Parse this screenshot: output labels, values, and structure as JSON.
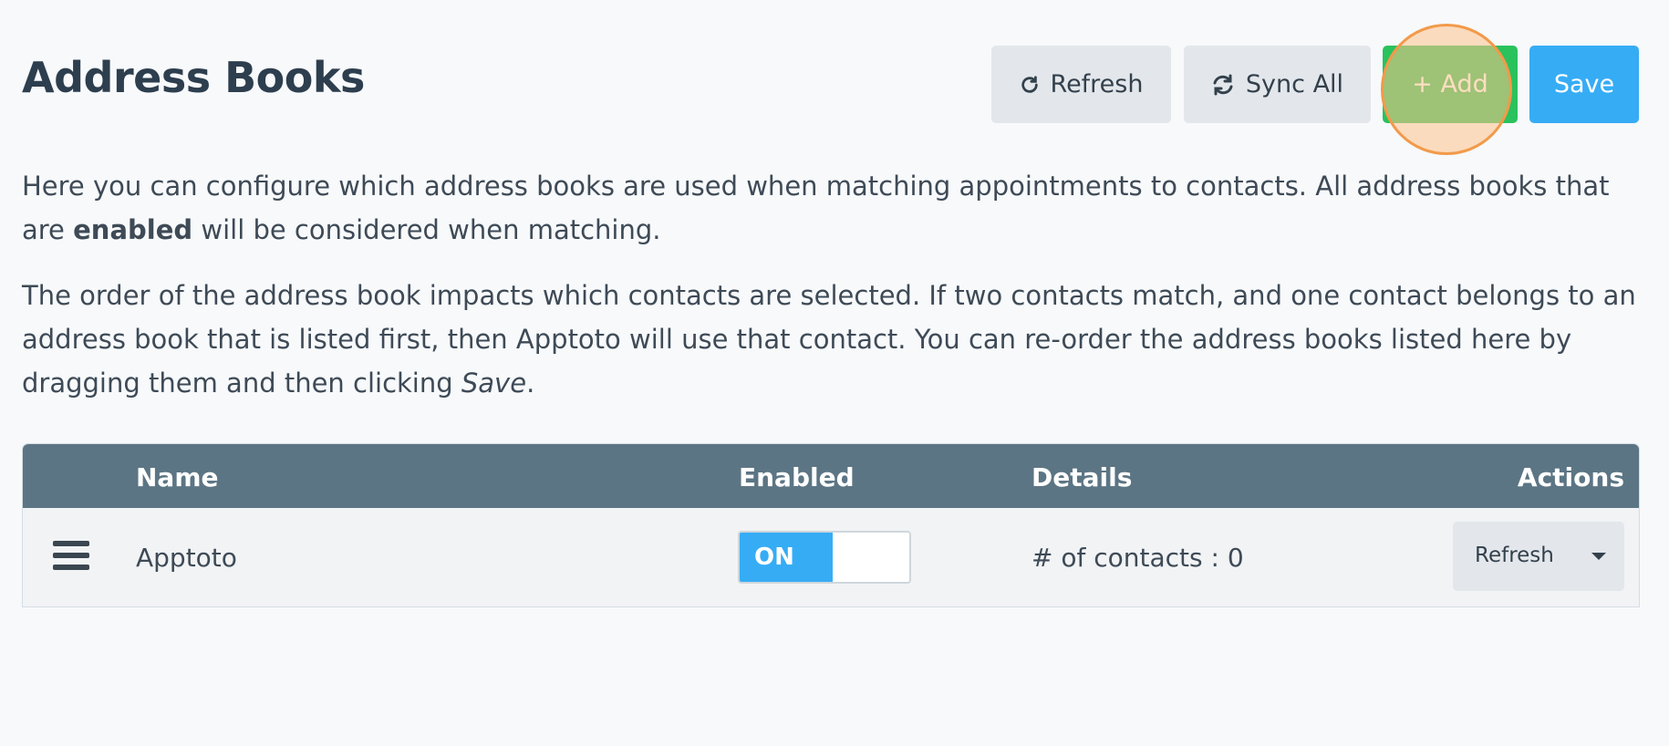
{
  "header": {
    "title": "Address Books",
    "refresh_label": "Refresh",
    "refresh_icon": "refresh-icon",
    "sync_label": "Sync All",
    "sync_icon": "sync-icon",
    "add_label": "+ Add",
    "save_label": "Save"
  },
  "description": {
    "p1_before": "Here you can configure which address books are used when matching appointments to contacts. All address books that are ",
    "p1_bold": "enabled",
    "p1_after": " will be considered when matching.",
    "p2_before": "The order of the address book impacts which contacts are selected. If two contacts match, and one contact belongs to an address book that is listed first, then Apptoto will use that contact. You can re-order the address books listed here by dragging them and then clicking ",
    "p2_italic": "Save",
    "p2_after": "."
  },
  "table": {
    "headers": {
      "name": "Name",
      "enabled": "Enabled",
      "details": "Details",
      "actions": "Actions"
    },
    "rows": [
      {
        "name": "Apptoto",
        "enabled_label": "ON",
        "enabled": true,
        "details": "# of contacts : 0",
        "action_label": "Refresh"
      }
    ]
  },
  "colors": {
    "header_bg": "#5c7584",
    "add_button": "#29c25c",
    "save_button": "#36acf5",
    "toggle_on": "#36acf5",
    "click_highlight": "#f29a4a"
  }
}
